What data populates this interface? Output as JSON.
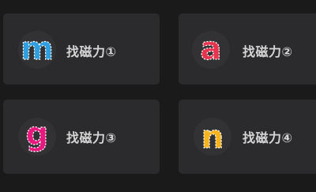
{
  "cards": [
    {
      "letter": "m",
      "label": "找磁力①",
      "color": "#2f9fe0",
      "icon": "letter-m-icon"
    },
    {
      "letter": "a",
      "label": "找磁力②",
      "color": "#e8334f",
      "icon": "letter-a-icon"
    },
    {
      "letter": "g",
      "label": "找磁力③",
      "color": "#e8187f",
      "icon": "letter-g-icon"
    },
    {
      "letter": "n",
      "label": "找磁力④",
      "color": "#f6b31b",
      "icon": "letter-n-icon"
    }
  ],
  "colors": {
    "background": "#1a1a1b",
    "card": "#2b2b2d",
    "badge": "#323234",
    "label": "#d6d6d6"
  }
}
